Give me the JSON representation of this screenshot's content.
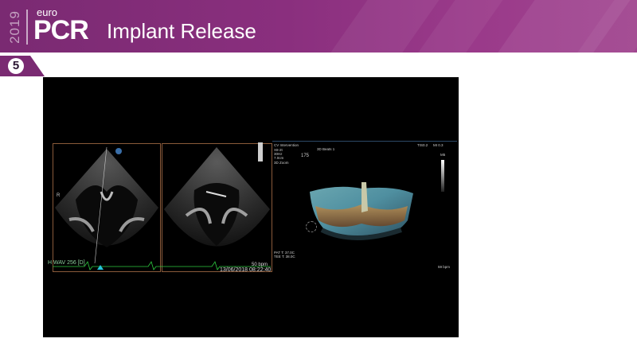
{
  "header": {
    "year": "2019",
    "logo_prefix": "euro",
    "logo_main": "PCR",
    "title": "Implant Release"
  },
  "step": {
    "number": "5"
  },
  "video": {
    "left_panel": {
      "ecg_label": "H WAV 256 [D]",
      "bpm": "50 bpm",
      "date": "13/06/2018 08:22:40",
      "side_marker": "R"
    },
    "right_panel": {
      "mode_label": "CV Intervention",
      "header_lines": [
        "X8-2t",
        "30Hz",
        "7.0cm",
        "3D Zoom"
      ],
      "beats_label": "3D Beats 1",
      "angle_value": "175",
      "tis": "TIS0.2",
      "mi": "MI 0.3",
      "scale_label": "M5",
      "temp_lines": [
        "PAT T: 37.0C",
        "TEE T: 38.0C"
      ],
      "bpm": "59 bpm"
    }
  }
}
